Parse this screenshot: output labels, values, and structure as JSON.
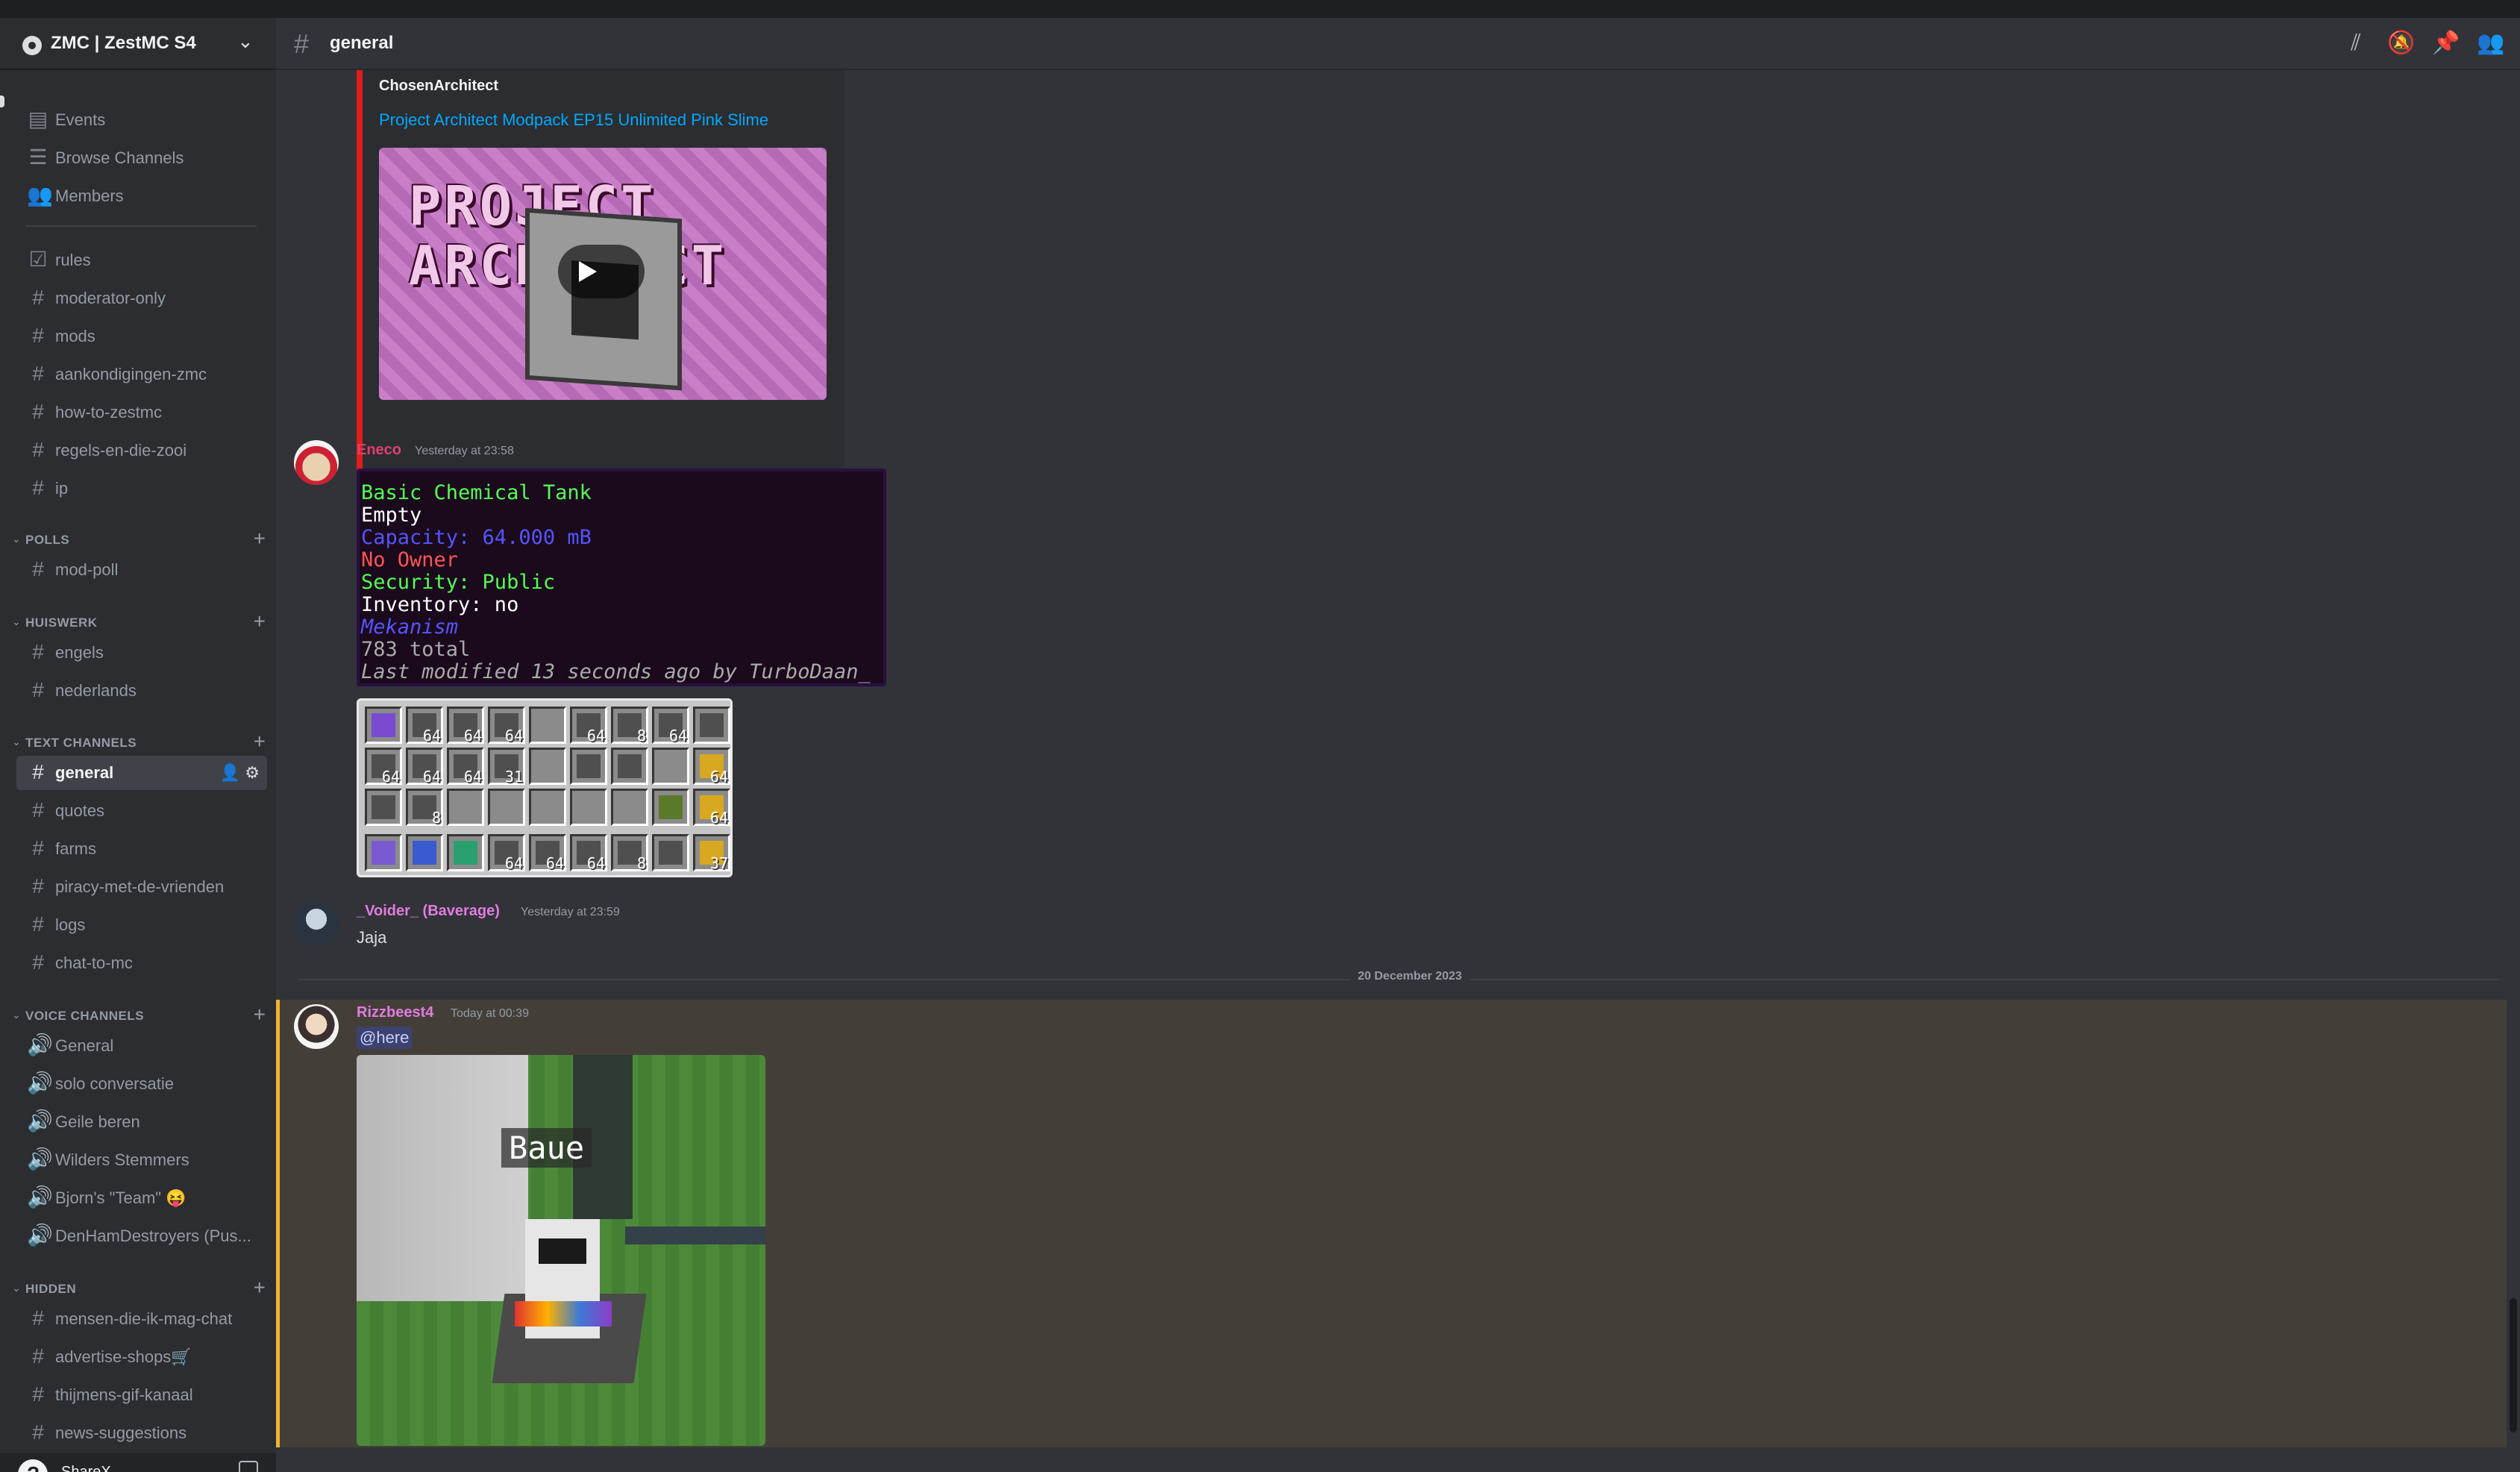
{
  "server": {
    "name": "ZMC | ZestMC S4"
  },
  "sidebar": {
    "nav": [
      {
        "label": "Events",
        "icon": "calendar-icon"
      },
      {
        "label": "Browse Channels",
        "icon": "browse-channels-icon"
      },
      {
        "label": "Members",
        "icon": "members-icon"
      }
    ],
    "top_channels": [
      {
        "label": "rules",
        "icon": "rules-icon"
      },
      {
        "label": "moderator-only",
        "icon": "hash-icon"
      },
      {
        "label": "mods",
        "icon": "hash-icon"
      },
      {
        "label": "aankondigingen-zmc",
        "icon": "hash-icon"
      },
      {
        "label": "how-to-zestmc",
        "icon": "hash-icon"
      },
      {
        "label": "regels-en-die-zooi",
        "icon": "hash-icon"
      },
      {
        "label": "ip",
        "icon": "hash-icon"
      }
    ],
    "categories": {
      "polls": {
        "name": "POLLS",
        "channels": [
          "mod-poll"
        ]
      },
      "huiswerk": {
        "name": "HUISWERK",
        "channels": [
          "engels",
          "nederlands"
        ]
      },
      "text": {
        "name": "TEXT CHANNELS",
        "channels": [
          "general",
          "quotes",
          "farms",
          "piracy-met-de-vrienden",
          "logs",
          "chat-to-mc"
        ]
      },
      "voice": {
        "name": "VOICE CHANNELS",
        "channels": [
          "General",
          "solo conversatie",
          "Geile beren",
          "Wilders Stemmers",
          "Bjorn's \"Team\" 😝",
          "DenHamDestroyers (Pus..."
        ]
      },
      "hidden": {
        "name": "HIDDEN",
        "channels": [
          "mensen-die-ik-mag-chat",
          "advertise-shops🛒",
          "thijmens-gif-kanaal",
          "news-suggestions"
        ]
      }
    },
    "active_channel": "general"
  },
  "user": {
    "name": "ShareX"
  },
  "header": {
    "channel": "general"
  },
  "embed": {
    "author": "ChosenArchitect",
    "title": "Project Architect Modpack EP15 Unlimited Pink Slime",
    "thumb_text_1": "PROJECT",
    "thumb_text_2": "ARCHITECT"
  },
  "messages": [
    {
      "author": "Eneco",
      "author_color": "#e03f6c",
      "time": "Yesterday at 23:58",
      "tooltip_lines": [
        {
          "text": "Basic Chemical Tank",
          "color": "#55ff55"
        },
        {
          "text": "Empty",
          "color": "#ffffff"
        },
        {
          "text": "Capacity: 64.000 mB",
          "color": "#5555ff"
        },
        {
          "text": "No Owner",
          "color": "#ff5555"
        },
        {
          "text": "Security: Public",
          "color": "#55ff55"
        },
        {
          "text": "Inventory: no",
          "color": "#ffffff"
        },
        {
          "text": "Mekanism",
          "color": "#5555ff"
        },
        {
          "text": "783 total",
          "color": "#aaaaaa"
        },
        {
          "text": "Last modified 13 seconds ago by TurboDaan_",
          "color": "#aaaaaa"
        }
      ],
      "inventory_counts": [
        [
          "",
          "64",
          "64",
          "64",
          "",
          "64",
          "8",
          "64",
          ""
        ],
        [
          "64",
          "64",
          "64",
          "31",
          "",
          "",
          "",
          "",
          "64"
        ],
        [
          "",
          "8",
          "",
          "",
          "",
          "",
          "",
          "",
          "64"
        ],
        [
          "",
          "",
          "",
          "64",
          "64",
          "64",
          "8",
          "",
          "37"
        ]
      ]
    },
    {
      "author": "_Voider_ (Baverage)",
      "author_color": "#e07ce0",
      "time": "Yesterday at 23:59",
      "text": "Jaja"
    },
    {
      "author": "Rizzbeest4",
      "author_color": "#e07ce0",
      "time": "Today at 00:39",
      "mention": "@here",
      "image_caption": "Baue"
    }
  ],
  "divider": "20 December 2023"
}
